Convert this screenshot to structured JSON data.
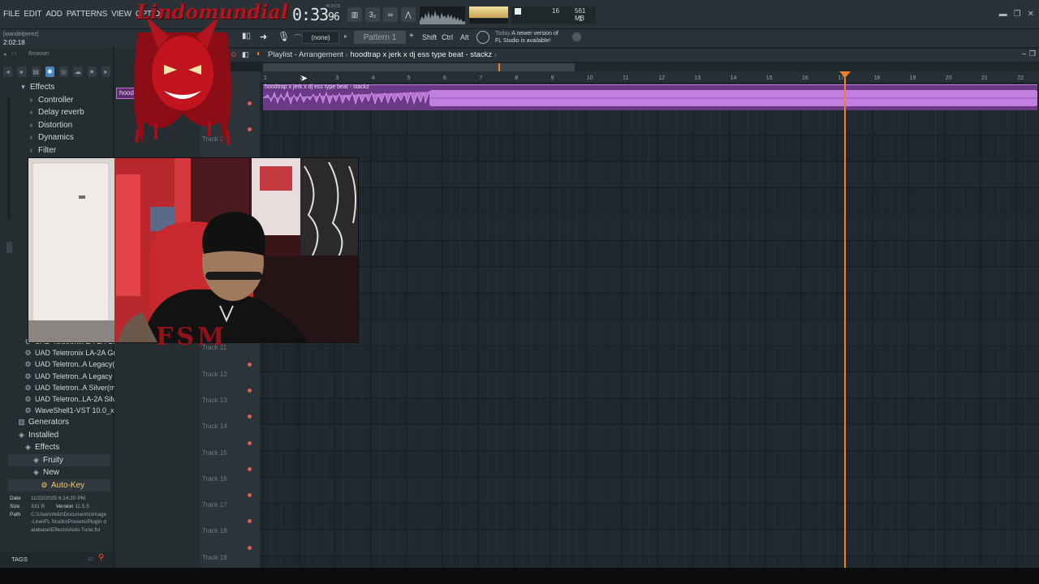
{
  "menu": [
    "FILE",
    "EDIT",
    "ADD",
    "PATTERNS",
    "VIEW",
    "OPTIO"
  ],
  "transport": {
    "time_main": "0:33",
    "time_frac": "96",
    "time_unit": "M:S:CS"
  },
  "monitor": {
    "voices": "16",
    "memory": "561 MB",
    "cpu": "1"
  },
  "user": {
    "name": "[wandelperez]",
    "duration": "2:02:18"
  },
  "toolbar": {
    "pattern_select": "(none)",
    "pattern_name": "Pattern 1",
    "keys": [
      "Shift",
      "Ctrl",
      "Alt"
    ]
  },
  "news": {
    "label": "Today",
    "line1": "A newer version of",
    "line2": "FL Studio is available!"
  },
  "browser": {
    "title": "Browser",
    "top_items": [
      "Effects",
      "Controller",
      "Delay reverb",
      "Distortion",
      "Dynamics",
      "Filter"
    ],
    "plugin_items": [
      "UAD Teletronix LA-2A Gray(m)",
      "UAD Teletronix LA-2A Gray",
      "UAD Teletron..A Legacy(m)",
      "UAD Teletron..A Legacy",
      "UAD Teletron..A Silver(m)",
      "UAD Teletron..LA-2A Silver",
      "WaveShell1-VST 10.0_x64"
    ],
    "bottom_items": [
      "Generators",
      "Installed",
      "Effects",
      "Fruity",
      "New",
      "Auto-Key"
    ],
    "info": {
      "date_label": "Date",
      "date": "11/22/2025 6:14:20 PM",
      "size_label": "Size",
      "size": "331 B",
      "version_label": "Version",
      "version": "11.5.5",
      "path_label": "Path",
      "path": "C:\\Users\\feliz\\Documents\\Image-Line\\FL Studio\\Presets\\Plugin database\\Effects\\Auto-Tune.fst"
    },
    "tags": "TAGS"
  },
  "overlay_label": "hoodtrap x jerk",
  "playlist": {
    "window": "Playlist - Arrangement",
    "song": "hoodtrap x jerk x dj ess type beat - stackz",
    "clip": "hoodtrap x jerk x dj ess type beat - stackz",
    "bars": [
      "1",
      "2",
      "3",
      "4",
      "5",
      "6",
      "7",
      "8",
      "9",
      "10",
      "11",
      "12",
      "13",
      "14",
      "15",
      "16",
      "17",
      "18",
      "19",
      "20",
      "21",
      "22"
    ],
    "tracks": [
      "Track 2",
      "Track 3",
      "Track 11",
      "Track 12",
      "Track 13",
      "Track 14",
      "Track 15",
      "Track 16",
      "Track 17",
      "Track 18",
      "Track 19"
    ],
    "playhead_bar": 17.2
  },
  "logo_text": "Lindomundial",
  "overlay_text": "FSM"
}
